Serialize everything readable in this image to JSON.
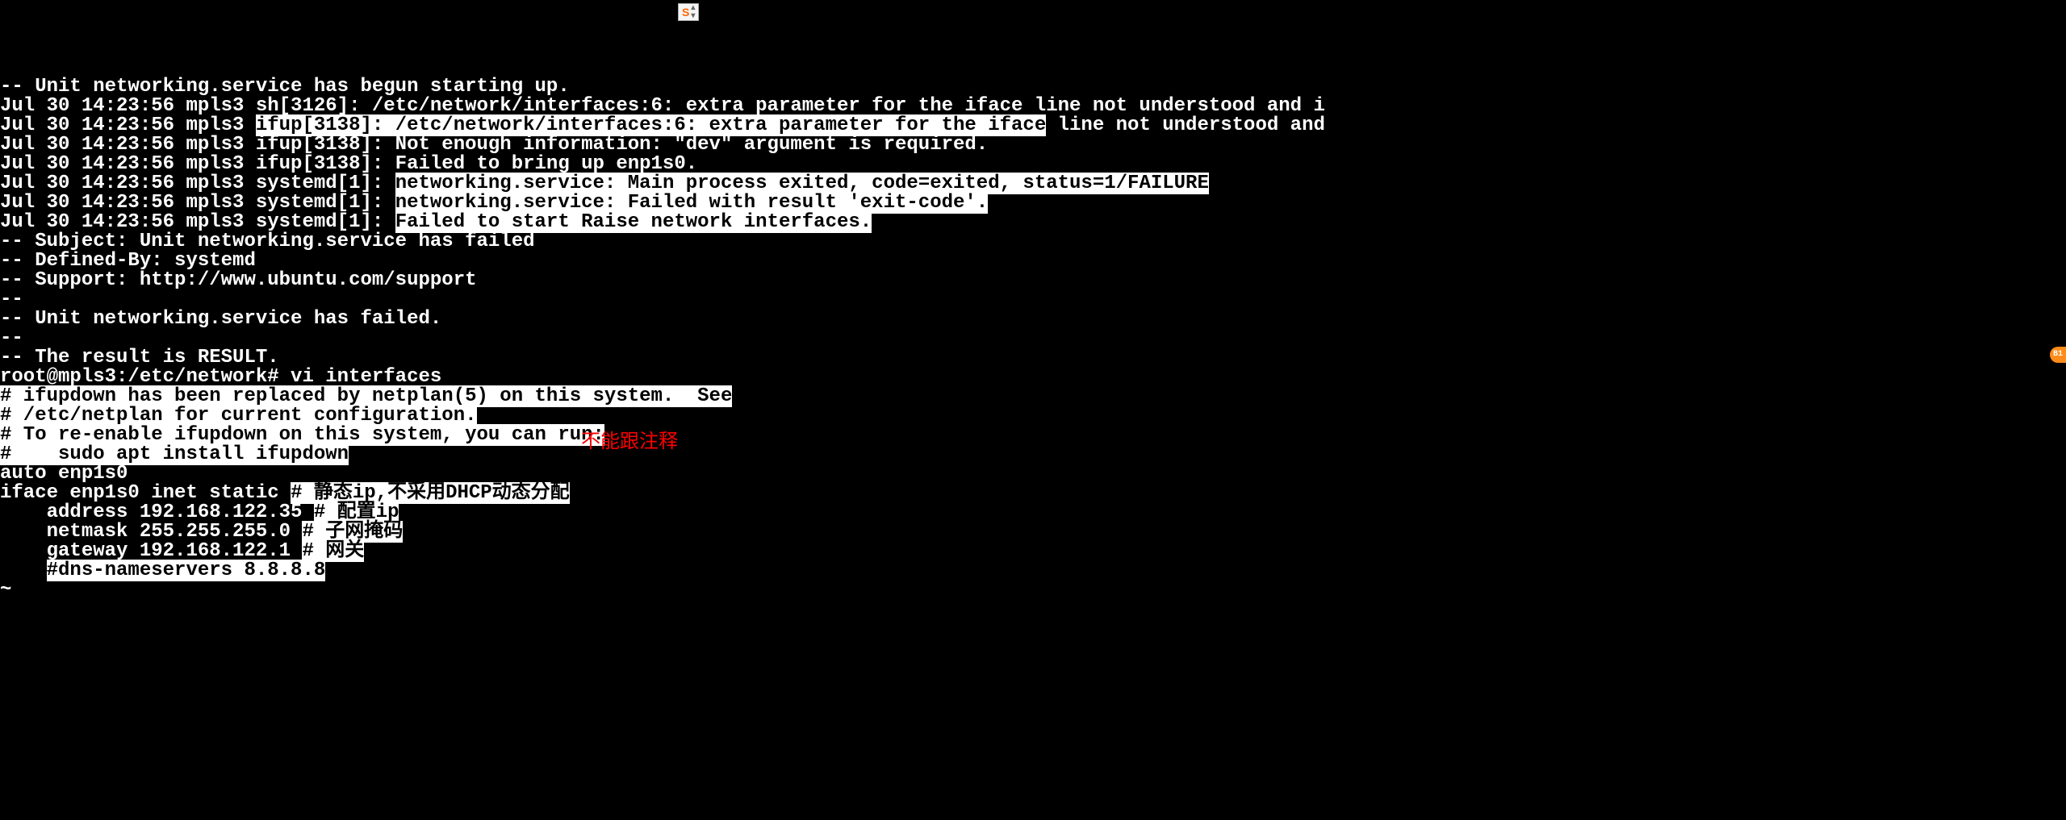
{
  "ime": {
    "label": "S"
  },
  "annotation": {
    "text": "不能跟注释"
  },
  "lines": [
    {
      "segments": [
        {
          "t": "-- Unit networking.service has begun starting up."
        }
      ]
    },
    {
      "segments": [
        {
          "t": "Jul 30 14:23:56 mpls3 sh[3126]: /etc/network/interfaces:6: extra parameter for the iface line not understood and i"
        }
      ]
    },
    {
      "segments": [
        {
          "t": "Jul 30 14:23:56 mpls3 "
        },
        {
          "t": "ifup[3138]: /etc/network/interfaces:6: extra parameter for the iface",
          "hl": true
        },
        {
          "t": " line not understood and"
        }
      ]
    },
    {
      "segments": [
        {
          "t": "Jul 30 14:23:56 mpls3 ifup[3138]: Not enough information: \"dev\" argument is required."
        }
      ]
    },
    {
      "segments": [
        {
          "t": "Jul 30 14:23:56 mpls3 ifup[3138]: Failed to bring up enp1s0."
        }
      ]
    },
    {
      "segments": [
        {
          "t": "Jul 30 14:23:56 mpls3 systemd[1]: "
        },
        {
          "t": "networking.service: Main process exited, code=exited, status=1/FAILURE",
          "hl": true
        }
      ]
    },
    {
      "segments": [
        {
          "t": "Jul 30 14:23:56 mpls3 systemd[1]: "
        },
        {
          "t": "networking.service: Failed with result 'exit-code'.",
          "hl": true
        }
      ]
    },
    {
      "segments": [
        {
          "t": "Jul 30 14:23:56 mpls3 systemd[1]: "
        },
        {
          "t": "Failed to start Raise network interfaces.",
          "hl": true
        }
      ]
    },
    {
      "segments": [
        {
          "t": "-- Subject: Unit networking.service has failed"
        }
      ]
    },
    {
      "segments": [
        {
          "t": "-- Defined-By: systemd"
        }
      ]
    },
    {
      "segments": [
        {
          "t": "-- Support: http://www.ubuntu.com/support"
        }
      ]
    },
    {
      "segments": [
        {
          "t": "--"
        }
      ]
    },
    {
      "segments": [
        {
          "t": "-- Unit networking.service has failed."
        }
      ]
    },
    {
      "segments": [
        {
          "t": "--"
        }
      ]
    },
    {
      "segments": [
        {
          "t": "-- The result is RESULT."
        }
      ]
    },
    {
      "segments": [
        {
          "t": "root@mpls3:/etc/network# vi interfaces"
        }
      ]
    },
    {
      "segments": [
        {
          "t": "# ifupdown has been replaced by netplan(5) on this system.  See",
          "hl": true
        }
      ]
    },
    {
      "segments": [
        {
          "t": "# /etc/netplan for current configuration.",
          "hl": true
        }
      ]
    },
    {
      "segments": [
        {
          "t": "# To re-enable ifupdown on this system, you can run:",
          "hl": true
        }
      ]
    },
    {
      "segments": [
        {
          "t": "#    sudo apt install ifupdown",
          "hl": true
        }
      ]
    },
    {
      "segments": [
        {
          "t": "auto enp1s0"
        }
      ]
    },
    {
      "segments": [
        {
          "t": "iface enp1s0 inet static "
        },
        {
          "t": "# 静态ip,不采用DHCP动态分配",
          "hl": true
        }
      ]
    },
    {
      "segments": [
        {
          "t": "    address 192.168.122.35 "
        },
        {
          "t": "# 配置ip",
          "hl": true
        }
      ]
    },
    {
      "segments": [
        {
          "t": "    netmask 255.255.255.0 "
        },
        {
          "t": "# 子网掩码",
          "hl": true
        }
      ]
    },
    {
      "segments": [
        {
          "t": "    gateway 192.168.122.1 "
        },
        {
          "t": "# 网关",
          "hl": true
        }
      ]
    },
    {
      "segments": [
        {
          "t": "    "
        },
        {
          "t": "#dns-nameservers 8.8.8.8",
          "hl": true
        }
      ]
    },
    {
      "segments": [
        {
          "t": "~"
        }
      ]
    }
  ]
}
